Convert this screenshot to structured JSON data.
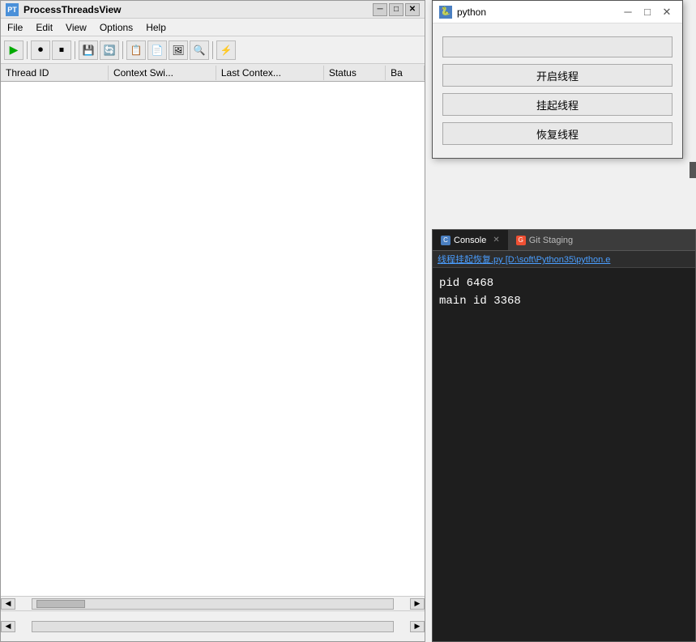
{
  "process_window": {
    "title": "ProcessThreadsView",
    "icon": "PT",
    "menu": [
      "File",
      "Edit",
      "View",
      "Options",
      "Help"
    ],
    "toolbar": {
      "buttons": [
        "play",
        "record",
        "stop",
        "save",
        "refresh",
        "copy",
        "copy2",
        "screenshot",
        "filter",
        "plugin"
      ]
    },
    "table": {
      "columns": [
        "Thread ID",
        "Context Swi...",
        "Last Contex...",
        "Status",
        "Ba"
      ],
      "rows": []
    },
    "scrollbar_thumb": ""
  },
  "python_window": {
    "title": "python",
    "icon": "py",
    "controls": [
      "minimize",
      "maximize",
      "close"
    ],
    "input_placeholder": "",
    "buttons": [
      "开启线程",
      "挂起线程",
      "恢复线程"
    ]
  },
  "console_panel": {
    "tabs": [
      {
        "label": "Console",
        "icon": "C",
        "active": true,
        "closeable": true
      },
      {
        "label": "Git Staging",
        "icon": "G",
        "active": false,
        "closeable": false
      }
    ],
    "file_link": "线程挂起恢复.py [D:\\soft\\Python35\\python.e",
    "output_lines": [
      "pid 6468",
      "main id 3368"
    ]
  }
}
